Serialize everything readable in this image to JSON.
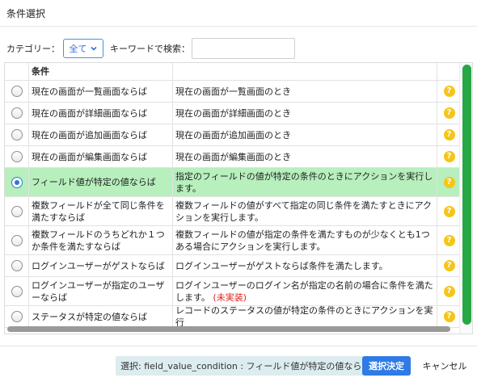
{
  "dialog": {
    "title": "条件選択"
  },
  "filter": {
    "category_label": "カテゴリー：",
    "category_value": "全て",
    "keyword_label": "キーワードで検索：",
    "keyword_value": ""
  },
  "table": {
    "header": {
      "condition": "条件"
    },
    "rows": [
      {
        "condition": "現在の画面が一覧画面ならば",
        "description": "現在の画面が一覧画面のとき",
        "selected": false
      },
      {
        "condition": "現在の画面が詳細画面ならば",
        "description": "現在の画面が詳細画面のとき",
        "selected": false
      },
      {
        "condition": "現在の画面が追加画面ならば",
        "description": "現在の画面が追加画面のとき",
        "selected": false
      },
      {
        "condition": "現在の画面が編集画面ならば",
        "description": "現在の画面が編集画面のとき",
        "selected": false
      },
      {
        "condition": "フィールド値が特定の値ならば",
        "description": "指定のフィールドの値が特定の条件のときにアクションを実行します。",
        "selected": true
      },
      {
        "condition": "複数フィールドが全て同じ条件を満たすならば",
        "description": "複数フィールドの値がすべて指定の同じ条件を満たすときにアクションを実行します。",
        "selected": false
      },
      {
        "condition": "複数フィールドのうちどれか１つか条件を満たすならば",
        "description": "複数フィールドの値が指定の条件を満たすものが少なくとも1つある場合にアクションを実行します。",
        "selected": false
      },
      {
        "condition": "ログインユーザーがゲストならば",
        "description": "ログインユーザーがゲストならば条件を満たします。",
        "selected": false
      },
      {
        "condition": "ログインユーザーが指定のユーザーならば",
        "description": "ログインユーザーのログイン名が指定の名前の場合に条件を満たします。",
        "note": "(未実装)",
        "selected": false
      },
      {
        "condition": "ステータスが特定の値ならば",
        "description": "レコードのステータスの値が特定の条件のときにアクションを実行",
        "selected": false
      }
    ],
    "help_glyph": "?"
  },
  "footer": {
    "selected_text": "選択: field_value_condition : フィールド値が特定の値ならば",
    "confirm_label": "選択決定",
    "cancel_label": "キャンセル"
  },
  "colors": {
    "selected_row": "#b7efbd",
    "scrollbar": "#28a745",
    "primary_button": "#2f7ae5",
    "help_icon": "#f5c518",
    "unimplemented": "#e0201b"
  },
  "icons": {
    "category_dropdown": "chevron-down-icon",
    "help": "question-circle-icon",
    "radio": "radio-button"
  }
}
